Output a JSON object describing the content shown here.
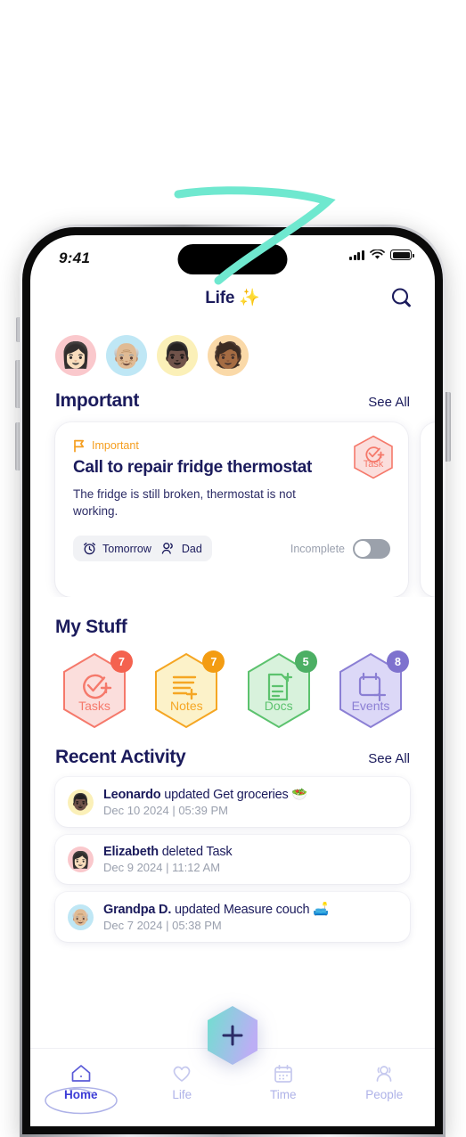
{
  "status_bar": {
    "time": "9:41",
    "signal_icon": "cellular-signal-icon",
    "wifi_icon": "wifi-icon",
    "battery_icon": "battery-full-icon"
  },
  "header": {
    "title": "Life ✨",
    "search_icon": "search-icon"
  },
  "avatars": [
    {
      "name": "avatar-elizabeth",
      "emoji": "👩🏻",
      "bg": "#FAC8CC"
    },
    {
      "name": "avatar-grandpa",
      "emoji": "👴🏼",
      "bg": "#BFE7F5"
    },
    {
      "name": "avatar-leonardo",
      "emoji": "👨🏿",
      "bg": "#FBF0B8"
    },
    {
      "name": "avatar-dad",
      "emoji": "🧑🏾",
      "bg": "#FAD9A8"
    }
  ],
  "important": {
    "title": "Important",
    "see_all": "See All",
    "card": {
      "flag_icon": "flag-icon",
      "flag_label": "Important",
      "title": "Call to repair fridge thermostat",
      "description": "The fridge is still broken, thermostat is not working.",
      "due_icon": "alarm-clock-icon",
      "due_label": "Tomorrow",
      "assignee_icon": "people-icon",
      "assignee_label": "Dad",
      "status_label": "Incomplete",
      "toggle_state": "off",
      "badge_label": "Task",
      "badge_icon": "check-circle-plus-icon",
      "badge_color": "#F5796B",
      "badge_fill": "#FBDEDC"
    }
  },
  "my_stuff": {
    "title": "My Stuff",
    "tiles": [
      {
        "label": "Tasks",
        "count": "7",
        "icon": "check-circle-plus-icon",
        "fill": "#FBDEDC",
        "stroke": "#F5796B",
        "badge": "#F4624F"
      },
      {
        "label": "Notes",
        "count": "7",
        "icon": "note-lines-plus-icon",
        "fill": "#FCF2C9",
        "stroke": "#F5A623",
        "badge": "#F39C12"
      },
      {
        "label": "Docs",
        "count": "5",
        "icon": "document-plus-icon",
        "fill": "#D8F2DC",
        "stroke": "#5CC26E",
        "badge": "#4CAF64"
      },
      {
        "label": "Events",
        "count": "8",
        "icon": "calendar-plus-icon",
        "fill": "#DCD8F7",
        "stroke": "#8B7FD4",
        "badge": "#7E72CE"
      }
    ]
  },
  "recent_activity": {
    "title": "Recent Activity",
    "see_all": "See All",
    "items": [
      {
        "avatar_emoji": "👨🏿",
        "avatar_bg": "#FBF0B8",
        "actor": "Leonardo",
        "action": " updated Get groceries 🥗",
        "timestamp": "Dec 10 2024 | 05:39 PM"
      },
      {
        "avatar_emoji": "👩🏻",
        "avatar_bg": "#FAC8CC",
        "actor": "Elizabeth",
        "action": " deleted Task",
        "timestamp": "Dec 9 2024 | 11:12 AM"
      },
      {
        "avatar_emoji": "👴🏼",
        "avatar_bg": "#BFE7F5",
        "actor": "Grandpa D.",
        "action": " updated Measure couch 🛋️",
        "timestamp": "Dec 7 2024 | 05:38 PM"
      }
    ]
  },
  "fab": {
    "icon": "plus-icon",
    "gradient_from": "#6FE0CF",
    "gradient_to": "#BCAEF5"
  },
  "tab_bar": {
    "active": "Home",
    "tabs": [
      {
        "label": "Home",
        "icon": "home-icon"
      },
      {
        "label": "Life",
        "icon": "heart-icon"
      },
      {
        "label": "Time",
        "icon": "calendar-icon"
      },
      {
        "label": "People",
        "icon": "people-icon"
      }
    ]
  },
  "decoration": {
    "squiggle_color": "#6FE8CF"
  }
}
